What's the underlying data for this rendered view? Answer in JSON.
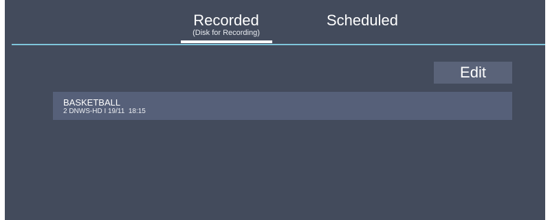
{
  "tabs": [
    {
      "label": "Recorded",
      "sublabel": "(Disk for Recording)",
      "active": true
    },
    {
      "label": "Scheduled",
      "active": false
    }
  ],
  "toolbar": {
    "edit_label": "Edit"
  },
  "recordings": [
    {
      "title": "BASKETBALL",
      "details": "2 DNWS-HD I 19/11  18:15"
    }
  ],
  "colors": {
    "background": "#434b5c",
    "accent_line": "#7fc6dc",
    "list_item": "#566079",
    "button": "#5a6379"
  }
}
